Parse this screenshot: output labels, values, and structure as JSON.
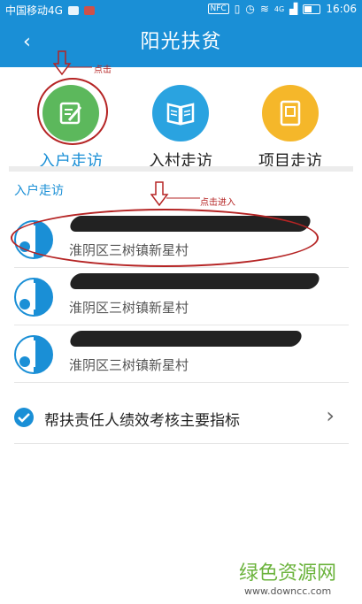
{
  "status_bar": {
    "carrier": "中国移动4G",
    "nfc": "NFC",
    "network": "4G",
    "time": "16:06"
  },
  "header": {
    "back_icon": "‹",
    "title": "阳光扶贫"
  },
  "tiles": [
    {
      "label": "入户走访",
      "icon": "edit-note-icon",
      "color": "#5cb85c"
    },
    {
      "label": "入村走访",
      "icon": "open-book-icon",
      "color": "#2aa3e0"
    },
    {
      "label": "项目走访",
      "icon": "document-icon",
      "color": "#f5b72a"
    }
  ],
  "annotations": {
    "tap": "点击",
    "tap_enter": "点击进入"
  },
  "section": {
    "title": "入户走访"
  },
  "visits": [
    {
      "location": "淮阴区三树镇新星村"
    },
    {
      "location": "淮阴区三树镇新星村"
    },
    {
      "location": "淮阴区三树镇新星村"
    }
  ],
  "kpi": {
    "label": "帮扶责任人绩效考核主要指标",
    "chevron": "›"
  },
  "watermark": {
    "name": "绿色资源网",
    "url": "www.downcc.com"
  },
  "colors": {
    "primary": "#1a8fd6",
    "annotation": "#b52424"
  }
}
